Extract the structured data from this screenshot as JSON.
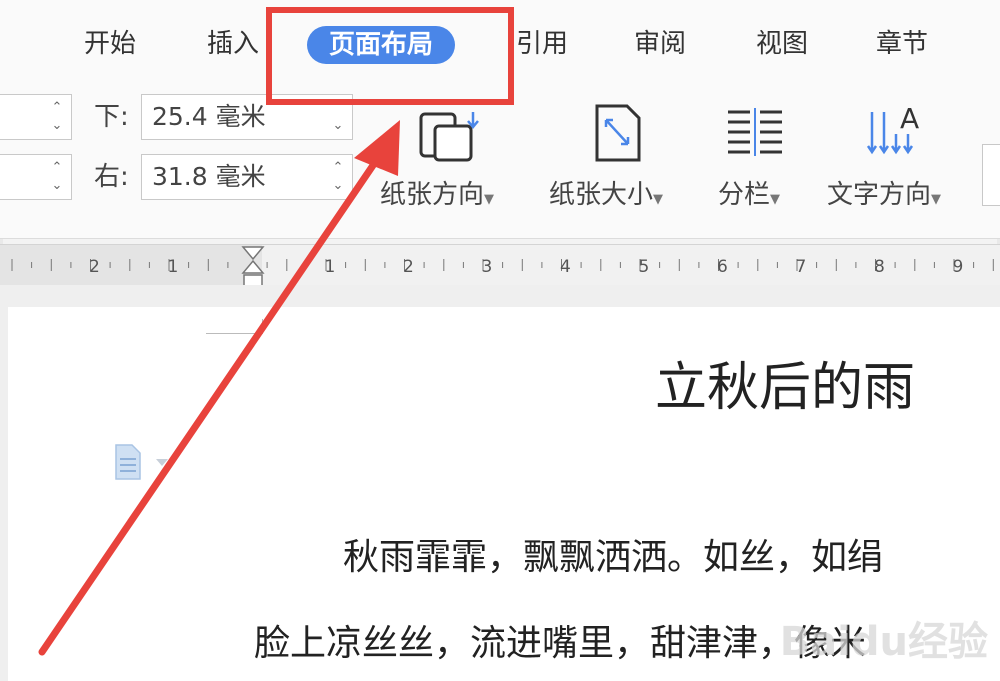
{
  "tabs": [
    "开始",
    "插入",
    "页面布局",
    "引用",
    "审阅",
    "视图",
    "章节"
  ],
  "active_tab": "页面布局",
  "margins": {
    "bottom_label": "下:",
    "bottom_value": "25.4 毫米",
    "right_label": "右:",
    "right_value": "31.8 毫米"
  },
  "tools": {
    "orientation": "纸张方向",
    "size": "纸张大小",
    "columns": "分栏",
    "text_direction": "文字方向"
  },
  "ruler_numbers": [
    "2",
    "1",
    "1",
    "2",
    "3",
    "4",
    "5",
    "6",
    "7",
    "8",
    "9"
  ],
  "document": {
    "title": "立秋后的雨",
    "line1": "秋雨霏霏，飘飘洒洒。如丝，如绢",
    "line2": "脸上凉丝丝，流进嘴里，甜津津，像米"
  },
  "colors": {
    "accent": "#4a86e8",
    "annotation": "#e8433c"
  },
  "watermark": "Baidu经验"
}
